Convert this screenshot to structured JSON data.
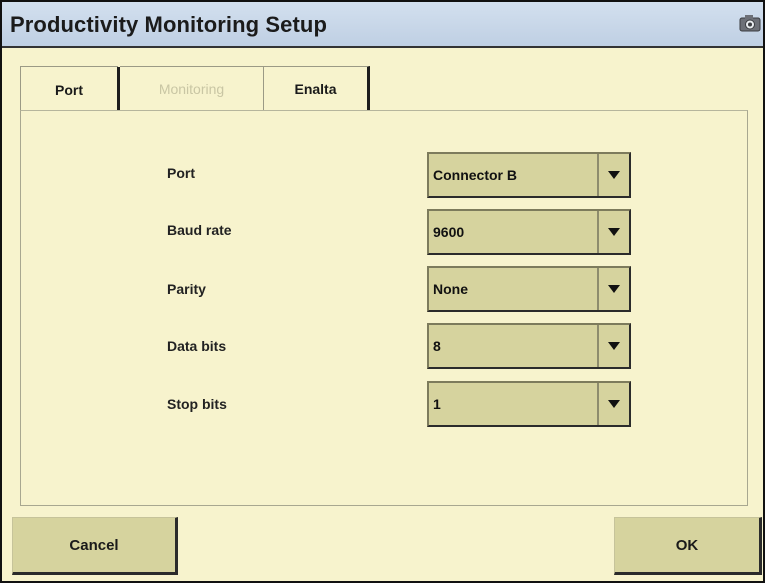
{
  "window": {
    "title": "Productivity Monitoring Setup"
  },
  "tabs": [
    {
      "label": "Port",
      "active": true
    },
    {
      "label": "Monitoring",
      "enabled": false
    },
    {
      "label": "Enalta"
    }
  ],
  "form": {
    "fields": [
      {
        "label": "Port",
        "value": "Connector B"
      },
      {
        "label": "Baud rate",
        "value": "9600"
      },
      {
        "label": "Parity",
        "value": "None"
      },
      {
        "label": "Data bits",
        "value": "8"
      },
      {
        "label": "Stop bits",
        "value": "1"
      }
    ]
  },
  "buttons": {
    "cancel": "Cancel",
    "ok": "OK"
  },
  "icons": {
    "title_bar": "camera-icon",
    "dropdown": "chevron-down-icon"
  },
  "colors": {
    "background": "#f7f3cd",
    "titlebar": "#c7d6e9",
    "control": "#d6d39e"
  }
}
